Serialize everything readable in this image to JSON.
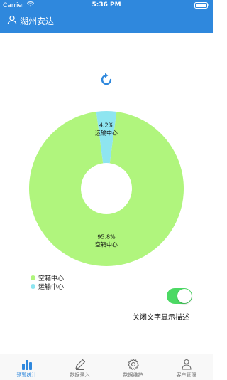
{
  "status": {
    "carrier": "Carrier",
    "time": "5:36 PM"
  },
  "nav": {
    "title": "湖州安达",
    "user_icon": "user-icon"
  },
  "colors": {
    "header_bg": "#2f88dd",
    "accent": "#2f88dd",
    "empty_center": "#b0f57d",
    "transport_center": "#8ee5f0",
    "toggle_on": "#4cd964"
  },
  "chart_data": {
    "type": "pie",
    "donut": true,
    "slices": [
      {
        "label": "空箱中心",
        "value": 95.8,
        "display": "95.8%"
      },
      {
        "label": "运输中心",
        "value": 4.2,
        "display": "4.2%"
      }
    ],
    "legend": [
      "空箱中心",
      "运输中心"
    ],
    "legend_position": "bottom-left"
  },
  "toggle": {
    "label": "关闭文字显示描述",
    "on": true
  },
  "tabs": [
    {
      "label": "预警统计",
      "icon": "bar-chart-icon",
      "active": true
    },
    {
      "label": "数据录入",
      "icon": "pencil-icon",
      "active": false
    },
    {
      "label": "数据维护",
      "icon": "gear-icon",
      "active": false
    },
    {
      "label": "客户管理",
      "icon": "users-icon",
      "active": false
    }
  ]
}
